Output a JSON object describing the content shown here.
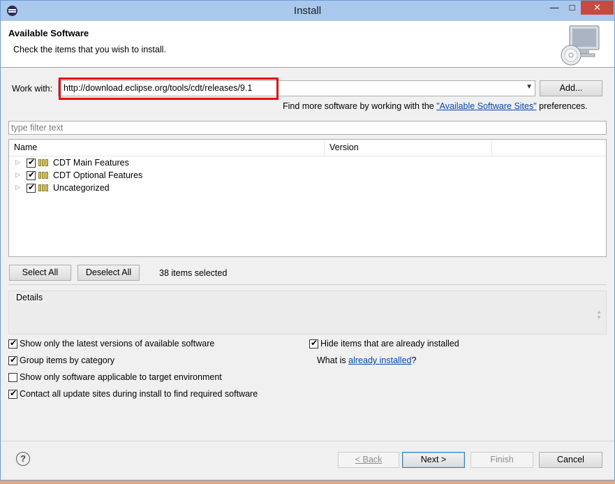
{
  "window": {
    "title": "Install",
    "controls": {
      "minimize": "—",
      "maximize": "□",
      "close": "✕"
    }
  },
  "banner": {
    "title": "Available Software",
    "description": "Check the items that you wish to install.",
    "icon": "install-cd-monitor-icon"
  },
  "work_with": {
    "label": "Work with:",
    "value": "http://download.eclipse.org/tools/cdt/releases/9.1",
    "add_button": "Add...",
    "hint_prefix": "Find more software by working with the ",
    "hint_link": "\"Available Software Sites\"",
    "hint_suffix": " preferences.",
    "highlight_color": "#e01010"
  },
  "filter": {
    "placeholder": "type filter text",
    "value": ""
  },
  "tree": {
    "columns": [
      "Name",
      "Version"
    ],
    "rows": [
      {
        "label": "CDT Main Features",
        "checked": true,
        "expanded": false
      },
      {
        "label": "CDT Optional Features",
        "checked": true,
        "expanded": false
      },
      {
        "label": "Uncategorized",
        "checked": true,
        "expanded": false
      }
    ]
  },
  "selection": {
    "select_all": "Select All",
    "deselect_all": "Deselect All",
    "status": "38 items selected"
  },
  "details": {
    "label": "Details"
  },
  "options": {
    "latest_versions": {
      "label": "Show only the latest versions of available software",
      "checked": true
    },
    "group_by_category": {
      "label": "Group items by category",
      "checked": true
    },
    "target_env": {
      "label": "Show only software applicable to target environment",
      "checked": false
    },
    "contact_sites": {
      "label": "Contact all update sites during install to find required software",
      "checked": true
    },
    "hide_installed": {
      "label": "Hide items that are already installed",
      "checked": true
    },
    "what_is_prefix": "What is ",
    "what_is_link": "already installed",
    "what_is_suffix": "?"
  },
  "footer": {
    "help": "?",
    "back": "< Back",
    "next": "Next >",
    "finish": "Finish",
    "cancel": "Cancel"
  }
}
